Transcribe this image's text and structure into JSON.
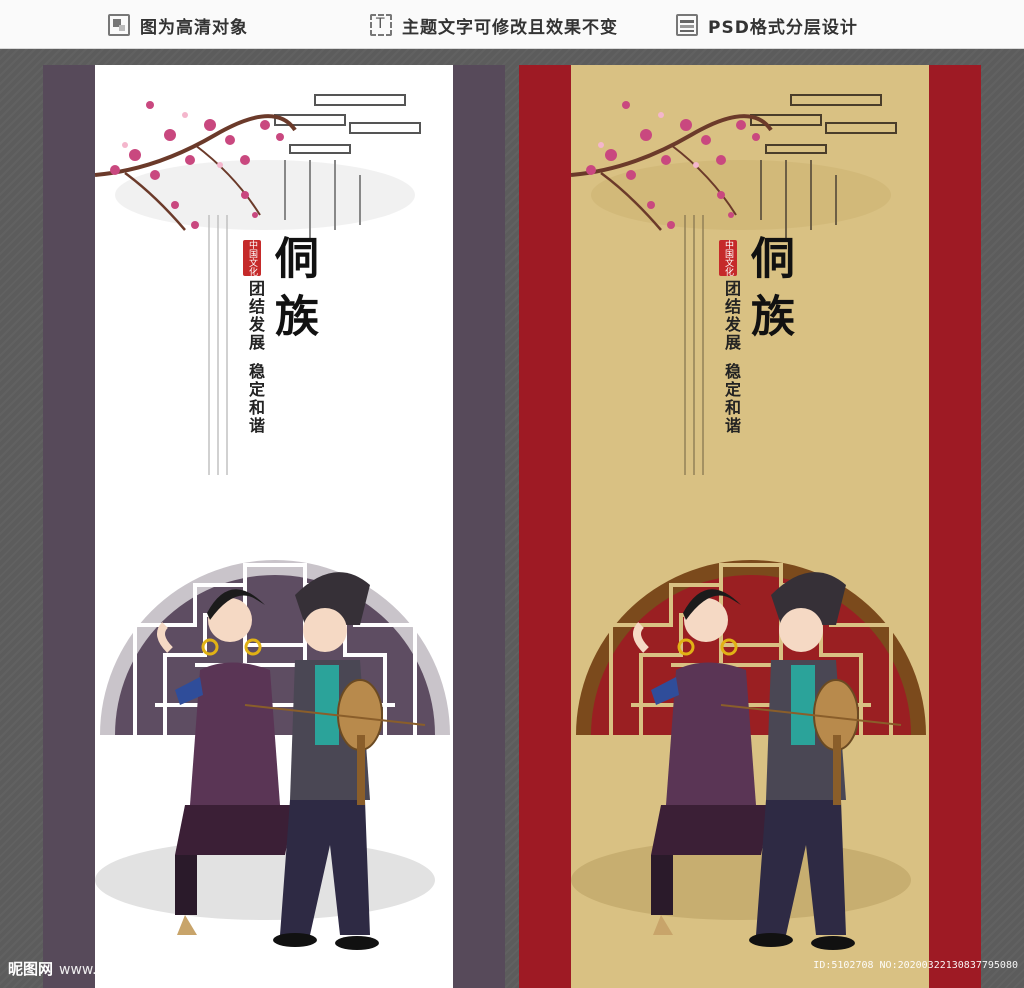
{
  "topbar": {
    "features": [
      {
        "label": "图为高清对象",
        "icon": "image-object-icon"
      },
      {
        "label": "主题文字可修改且效果不变",
        "icon": "text-edit-icon"
      },
      {
        "label": "PSD格式分层设计",
        "icon": "layers-icon"
      }
    ]
  },
  "posters": [
    {
      "name": "purple-white",
      "title": "侗族",
      "seal": "中国文化",
      "slogan_1": "团结发展",
      "slogan_2": "稳定和谐",
      "colors": {
        "stripe": "#574a5a",
        "background": "#ffffff",
        "window": "#5e4d62"
      }
    },
    {
      "name": "red-gold",
      "title": "侗族",
      "seal": "中国文化",
      "slogan_1": "团结发展",
      "slogan_2": "稳定和谐",
      "colors": {
        "stripe": "#9e1a24",
        "background": "#d9c183",
        "window": "#9a1f22"
      }
    }
  ],
  "watermark": {
    "brand": "昵图网",
    "url": "www.nipic.com",
    "id_text": "ID:5102708 NO:20200322130837795080"
  }
}
